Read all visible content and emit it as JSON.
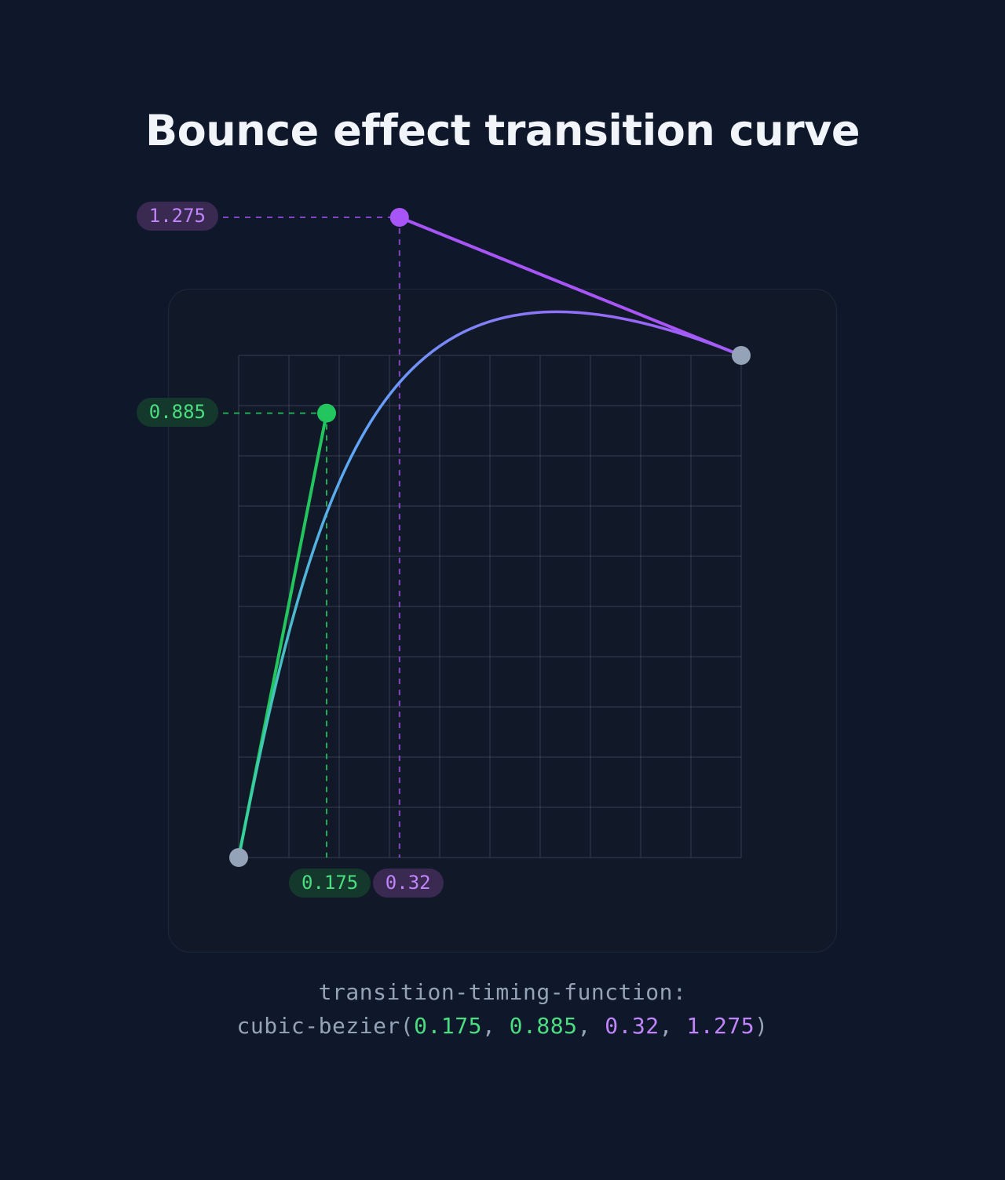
{
  "title": "Bounce effect transition curve",
  "chart_data": {
    "type": "line",
    "xlim": [
      0,
      1
    ],
    "ylim": [
      0,
      1
    ],
    "grid": true,
    "grid_divisions": 10,
    "bezier": {
      "p0": {
        "x": 0,
        "y": 0
      },
      "p1": {
        "x": 0.175,
        "y": 0.885
      },
      "p2": {
        "x": 0.32,
        "y": 1.275
      },
      "p3": {
        "x": 1,
        "y": 1
      }
    },
    "labels": {
      "p1_x": "0.175",
      "p1_y": "0.885",
      "p2_x": "0.32",
      "p2_y": "1.275"
    },
    "colors": {
      "control1": "#22c55e",
      "control2": "#a855f7",
      "endpoint": "#94a3b8",
      "grid": "#334155",
      "curve_start": "#34d399",
      "curve_mid": "#60a5fa",
      "curve_end": "#a855f7",
      "badge_green_bg": "#14392c",
      "badge_green_fg": "#4ade80",
      "badge_purple_bg": "#3a2a52",
      "badge_purple_fg": "#c084fc"
    }
  },
  "code": {
    "property": "transition-timing-function:",
    "fn": "cubic-bezier",
    "open": "(",
    "close": ")",
    "sep": ", ",
    "v1": "0.175",
    "v2": "0.885",
    "v3": "0.32",
    "v4": "1.275"
  }
}
